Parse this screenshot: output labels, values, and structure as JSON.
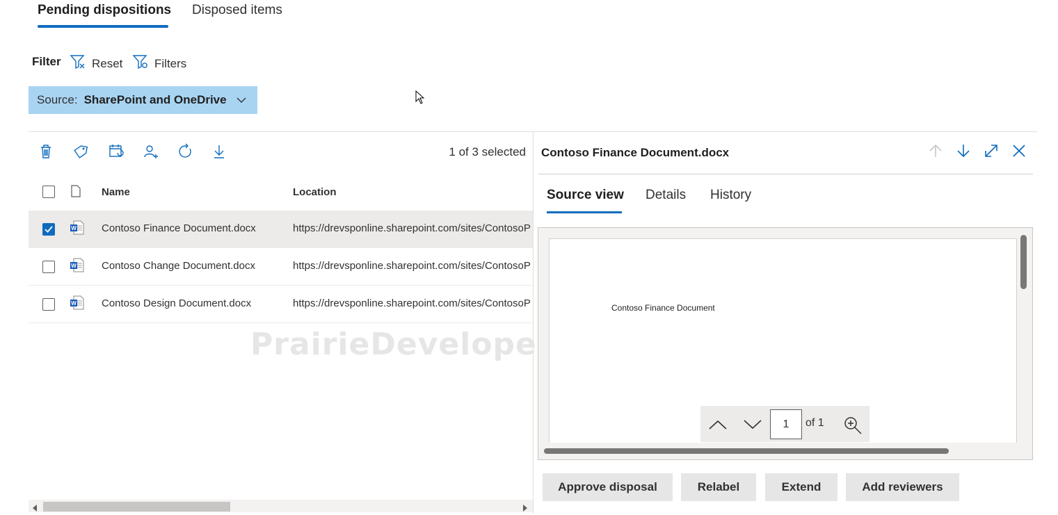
{
  "tabs": [
    "Pending dispositions",
    "Disposed items"
  ],
  "filter": {
    "label": "Filter",
    "reset": "Reset",
    "filters": "Filters"
  },
  "source": {
    "prefix": "Source:",
    "value": "SharePoint and OneDrive"
  },
  "toolbar": {
    "icons": [
      "delete-icon",
      "relabel-icon",
      "extend-icon",
      "add-reviewer-icon",
      "refresh-icon",
      "download-icon"
    ],
    "selected_count": "1 of 3 selected"
  },
  "table": {
    "columns": [
      "Name",
      "Location"
    ],
    "rows": [
      {
        "name": "Contoso Finance Document.docx",
        "location": "https://drevsponline.sharepoint.com/sites/ContosoP",
        "selected": true
      },
      {
        "name": "Contoso Change Document.docx",
        "location": "https://drevsponline.sharepoint.com/sites/ContosoP",
        "selected": false
      },
      {
        "name": "Contoso Design Document.docx",
        "location": "https://drevsponline.sharepoint.com/sites/ContosoP",
        "selected": false
      }
    ]
  },
  "watermark": "PrairieDeveloper.com",
  "pane": {
    "title": "Contoso Finance Document.docx",
    "tabs": [
      "Source view",
      "Details",
      "History"
    ],
    "document_text": "Contoso Finance Document",
    "page_number": "1",
    "page_of": "of 1",
    "actions": [
      "Approve disposal",
      "Relabel",
      "Extend",
      "Add reviewers"
    ]
  },
  "colors": {
    "accent": "#0f6cbd",
    "source_bg": "#a8d4f2",
    "selected_row": "#edebe9"
  }
}
